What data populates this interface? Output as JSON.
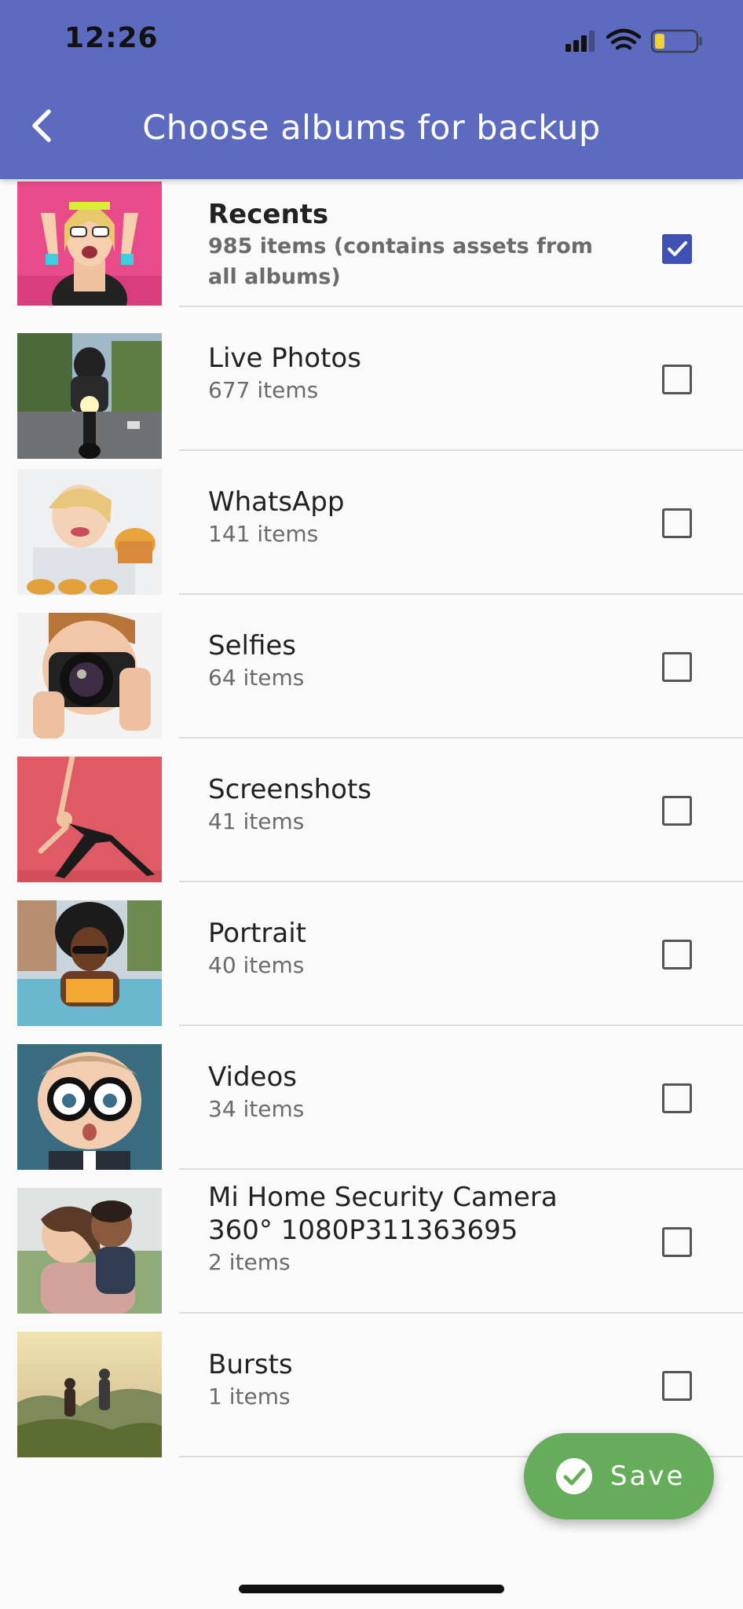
{
  "status_bar": {
    "time": "12:26"
  },
  "header": {
    "title": "Choose albums for backup",
    "back_icon": "chevron-left-icon",
    "background_color": "#5c6bc0"
  },
  "albums": [
    {
      "name": "Recents",
      "count": "985 items (contains assets from all albums)",
      "checked": true,
      "thumbnail": "girl-pink-background-photo"
    },
    {
      "name": "Live Photos",
      "count": "677 items",
      "checked": false,
      "thumbnail": "motorcyclist-photo"
    },
    {
      "name": "WhatsApp",
      "count": "141 items",
      "checked": false,
      "thumbnail": "child-muffins-photo"
    },
    {
      "name": "Selfies",
      "count": "64 items",
      "checked": false,
      "thumbnail": "photographer-camera-photo"
    },
    {
      "name": "Screenshots",
      "count": "41 items",
      "checked": false,
      "thumbnail": "yoga-pose-photo"
    },
    {
      "name": "Portrait",
      "count": "40 items",
      "checked": false,
      "thumbnail": "woman-pool-photo"
    },
    {
      "name": "Videos",
      "count": "34 items",
      "checked": false,
      "thumbnail": "child-glasses-photo"
    },
    {
      "name": "Mi Home Security Camera 360° 1080P311363695",
      "count": "2 items",
      "checked": false,
      "thumbnail": "mother-child-photo"
    },
    {
      "name": "Bursts",
      "count": "1 items",
      "checked": false,
      "thumbnail": "hikers-sunset-photo"
    }
  ],
  "save_button": {
    "label": "Save",
    "icon": "check-circle-icon",
    "color": "#66ad5b"
  },
  "checkbox_color": "#3f51b5"
}
